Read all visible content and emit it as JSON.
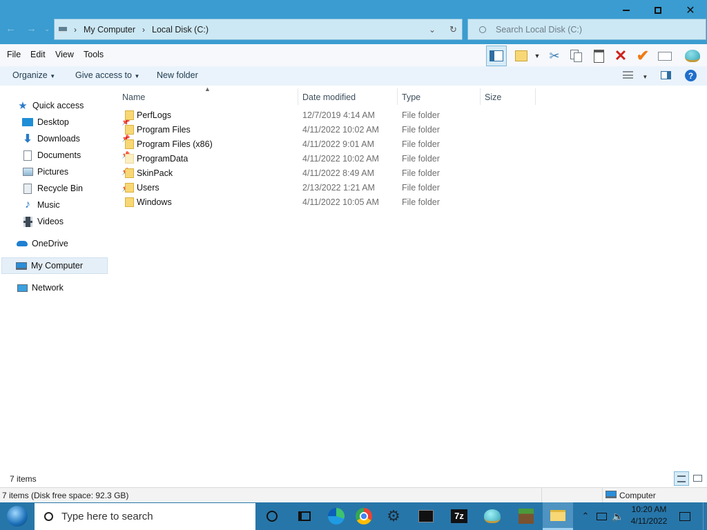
{
  "window": {
    "minimize_icon": "minimize-icon",
    "restore_icon": "restore-icon",
    "close_icon": "close-icon"
  },
  "address": {
    "crumbs": [
      "My Computer",
      "Local Disk (C:)"
    ],
    "search_placeholder": "Search Local Disk (C:)"
  },
  "menu": [
    "File",
    "Edit",
    "View",
    "Tools"
  ],
  "commands": {
    "organize": "Organize",
    "give_access": "Give access to",
    "new_folder": "New folder"
  },
  "sidebar": {
    "quick_access": "Quick access",
    "items": [
      {
        "label": "Desktop",
        "pinned": true
      },
      {
        "label": "Downloads",
        "pinned": true
      },
      {
        "label": "Documents",
        "pinned": true
      },
      {
        "label": "Pictures",
        "pinned": true
      },
      {
        "label": "Recycle Bin",
        "pinned": true
      },
      {
        "label": "Music",
        "pinned": false
      },
      {
        "label": "Videos",
        "pinned": false
      }
    ],
    "onedrive": "OneDrive",
    "my_computer": "My Computer",
    "network": "Network"
  },
  "columns": [
    "Name",
    "Date modified",
    "Type",
    "Size"
  ],
  "files": [
    {
      "name": "PerfLogs",
      "date": "12/7/2019 4:14 AM",
      "type": "File folder"
    },
    {
      "name": "Program Files",
      "date": "4/11/2022 10:02 AM",
      "type": "File folder"
    },
    {
      "name": "Program Files (x86)",
      "date": "4/11/2022 9:01 AM",
      "type": "File folder"
    },
    {
      "name": "ProgramData",
      "date": "4/11/2022 10:02 AM",
      "type": "File folder"
    },
    {
      "name": "SkinPack",
      "date": "4/11/2022 8:49 AM",
      "type": "File folder"
    },
    {
      "name": "Users",
      "date": "2/13/2022 1:21 AM",
      "type": "File folder"
    },
    {
      "name": "Windows",
      "date": "4/11/2022 10:05 AM",
      "type": "File folder"
    }
  ],
  "status": {
    "item_count": "7 items",
    "detail": "7 items (Disk free space: 92.3 GB)",
    "location": "Computer"
  },
  "taskbar": {
    "search_placeholder": "Type here to search",
    "time": "10:20 AM",
    "date": "4/11/2022",
    "sevenzip_label": "7z"
  },
  "colors": {
    "titlebar": "#3a9cd0",
    "taskbar": "#2776a9",
    "folder": "#f8d775",
    "link": "#1e3a4f"
  }
}
